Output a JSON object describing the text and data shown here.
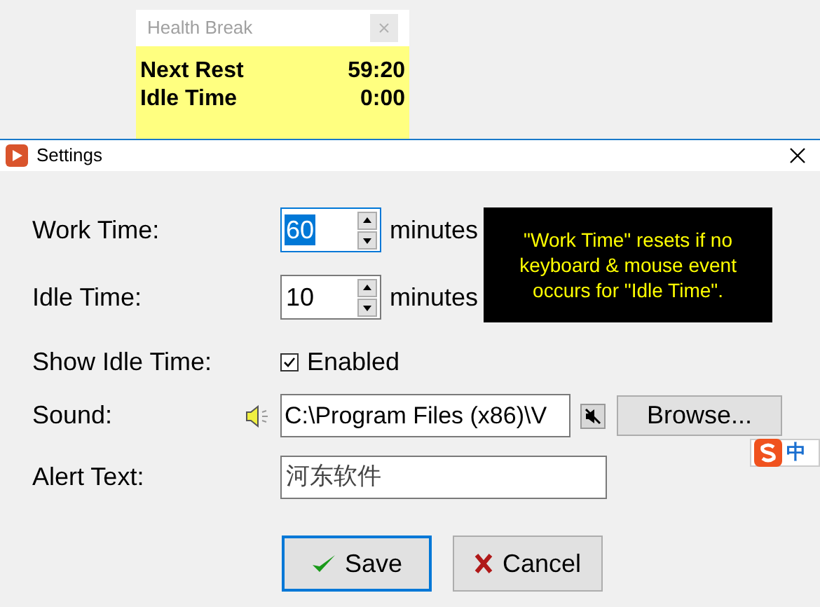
{
  "break_window": {
    "title": "Health Break",
    "rows": [
      {
        "label": "Next Rest",
        "value": "59:20"
      },
      {
        "label": "Idle Time",
        "value": "0:00"
      }
    ]
  },
  "settings": {
    "title": "Settings",
    "work_time": {
      "label": "Work Time:",
      "value": "60",
      "unit": "minutes",
      "selected": true
    },
    "idle_time": {
      "label": "Idle Time:",
      "value": "10",
      "unit": "minutes",
      "selected": false
    },
    "hint": "\"Work Time\" resets if no keyboard & mouse event occurs for \"Idle Time\".",
    "show_idle": {
      "label": "Show Idle Time:",
      "checkbox_label": "Enabled",
      "checked": true
    },
    "sound": {
      "label": "Sound:",
      "value": "C:\\Program Files (x86)\\V",
      "muted": true,
      "button": "Browse..."
    },
    "alert": {
      "label": "Alert Text:",
      "value": "河东软件"
    },
    "buttons": [
      {
        "kind": "save",
        "label": "Save",
        "default": true
      },
      {
        "kind": "cancel",
        "label": "Cancel",
        "default": false
      }
    ]
  },
  "ime": {
    "label": "中"
  }
}
